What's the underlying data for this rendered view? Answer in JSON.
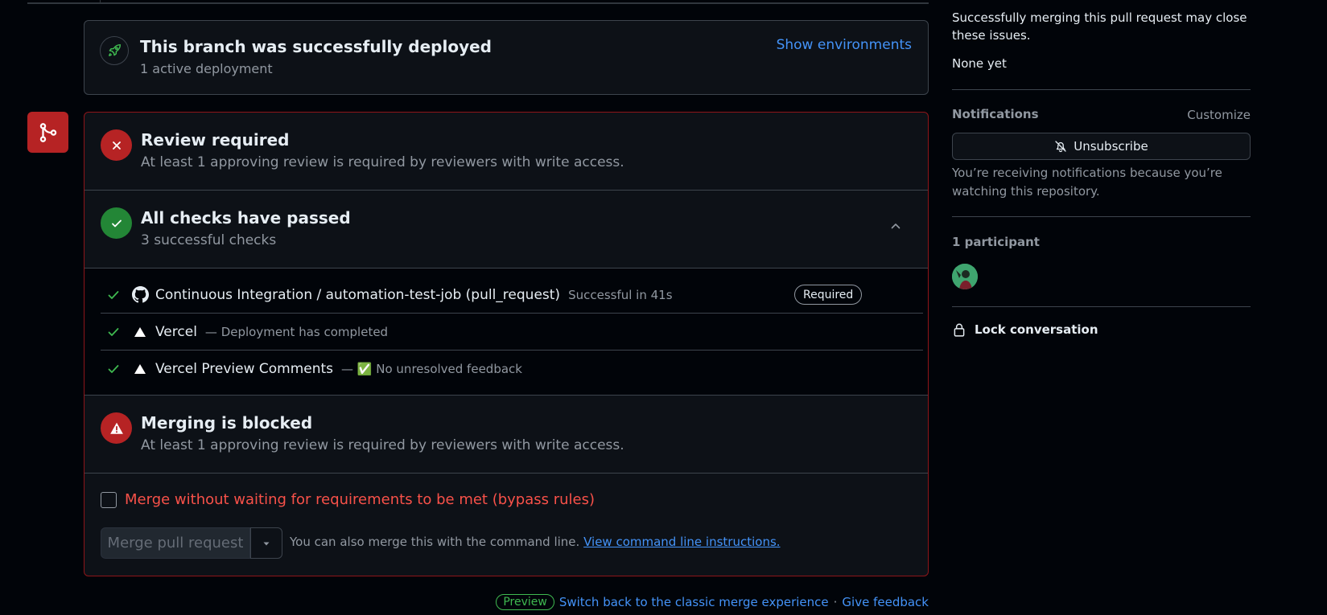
{
  "deployment": {
    "title": "This branch was successfully deployed",
    "subtitle": "1 active deployment",
    "action": "Show environments"
  },
  "review": {
    "title": "Review required",
    "subtitle": "At least 1 approving review is required by reviewers with write access."
  },
  "checks": {
    "title": "All checks have passed",
    "subtitle": "3 successful checks",
    "items": [
      {
        "name": "Continuous Integration / automation-test-job (pull_request)",
        "desc": "Successful in 41s",
        "badge": "Required",
        "logo": "github-icon"
      },
      {
        "name": "Vercel",
        "desc": "— Deployment has completed",
        "logo": "vercel-icon"
      },
      {
        "name": "Vercel Preview Comments",
        "desc": "— ✅ No unresolved feedback",
        "logo": "vercel-icon"
      }
    ]
  },
  "blocked": {
    "title": "Merging is blocked",
    "subtitle": "At least 1 approving review is required by reviewers with write access."
  },
  "actions": {
    "bypass_label": "Merge without waiting for requirements to be met (bypass rules)",
    "merge_button": "Merge pull request",
    "cmd_text": "You can also merge this with the command line.",
    "cmd_link": "View command line instructions."
  },
  "footer": {
    "preview": "Preview",
    "switch_link": "Switch back to the classic merge experience",
    "separator": "·",
    "feedback_link": "Give feedback"
  },
  "sidebar": {
    "issues_text": "Successfully merging this pull request may close these issues.",
    "issues_value": "None yet",
    "notifications_heading": "Notifications",
    "customize": "Customize",
    "unsubscribe": "Unsubscribe",
    "notif_reason": "You’re receiving notifications because you’re watching this repository.",
    "participants": "1 participant",
    "lock": "Lock conversation"
  },
  "colors": {
    "accent": "#4493f8",
    "danger": "#b62324",
    "success": "#238636",
    "background": "#010409"
  }
}
